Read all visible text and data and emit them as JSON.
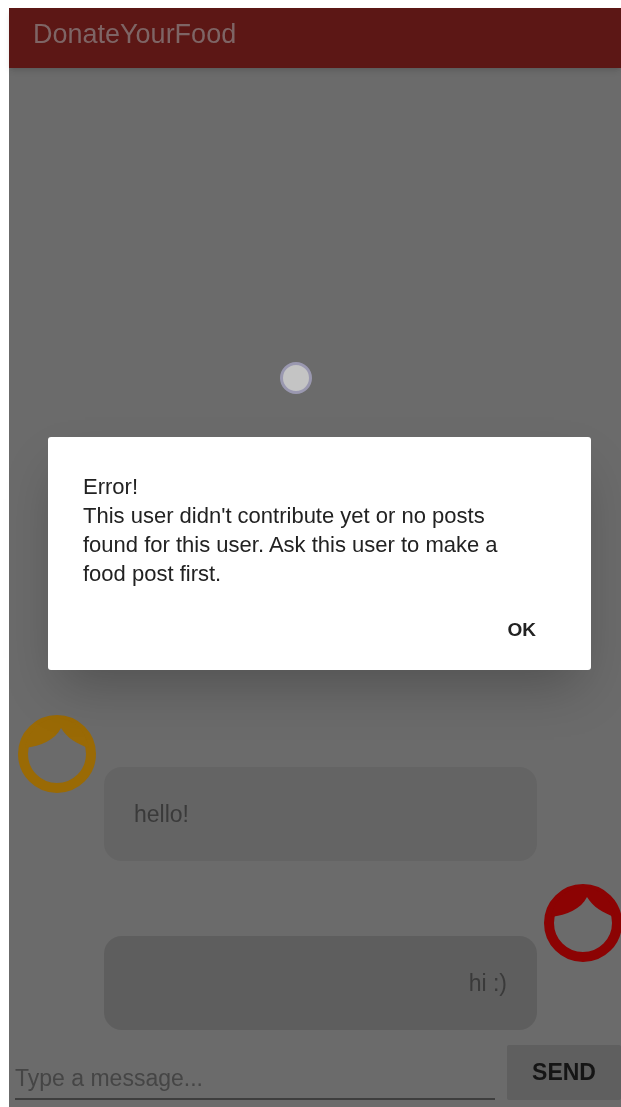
{
  "app_bar": {
    "title": "DonateYourFood"
  },
  "messages": [
    {
      "text": "hello!",
      "kind": "incoming",
      "color": "#9a6a05"
    },
    {
      "text": "hi :)",
      "kind": "outgoing",
      "color": "#8c0303"
    }
  ],
  "composer": {
    "placeholder": "Type a message...",
    "button": "SEND"
  },
  "dialog": {
    "title": "Error!",
    "message": "This user didn't contribute yet or no posts found for this user. Ask this user to make a food post first.",
    "button": "OK"
  }
}
